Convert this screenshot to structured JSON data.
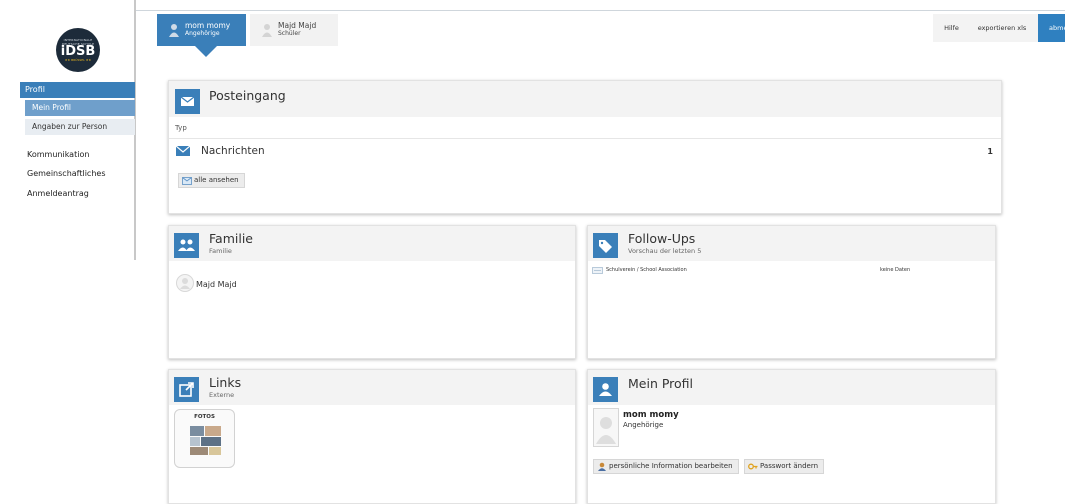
{
  "sidebar": {
    "logo": {
      "line1": "INTERNATIONALE DEUTSCHE SCHULE",
      "main": "iDSB",
      "line3": "★★ BRÜSSEL ★★"
    },
    "profil": "Profil",
    "profil_items": [
      "Mein Profil",
      "Angaben zur Person"
    ],
    "items": [
      "Kommunikation",
      "Gemeinschaftliches",
      "Anmeldeantrag"
    ]
  },
  "user_tabs": [
    {
      "name": "mom momy",
      "role": "Angehörige"
    },
    {
      "name": "Majd Majd",
      "role": "Schüler"
    }
  ],
  "top_buttons": {
    "help": "Hilfe",
    "export": "exportieren xls",
    "logout": "abmelden"
  },
  "inbox": {
    "title": "Posteingang",
    "column": "Typ",
    "row_label": "Nachrichten",
    "row_count": "1",
    "view_all": "alle ansehen"
  },
  "family": {
    "title": "Familie",
    "subtitle": "Familie",
    "member": "Majd Majd"
  },
  "followups": {
    "title": "Follow-Ups",
    "subtitle": "Vorschau der letzten 5",
    "row_name": "Schulverein / School Association",
    "row_status": "keine Daten"
  },
  "links": {
    "title": "Links",
    "subtitle": "Externe",
    "tile_label": "FOTOS"
  },
  "profile": {
    "title": "Mein Profil",
    "name": "mom momy",
    "role": "Angehörige",
    "edit_button": "persönliche Information bearbeiten",
    "password_button": "Passwort ändern"
  },
  "colors": {
    "accent": "#3a7fb9",
    "panel_header": "#f3f3f3"
  }
}
